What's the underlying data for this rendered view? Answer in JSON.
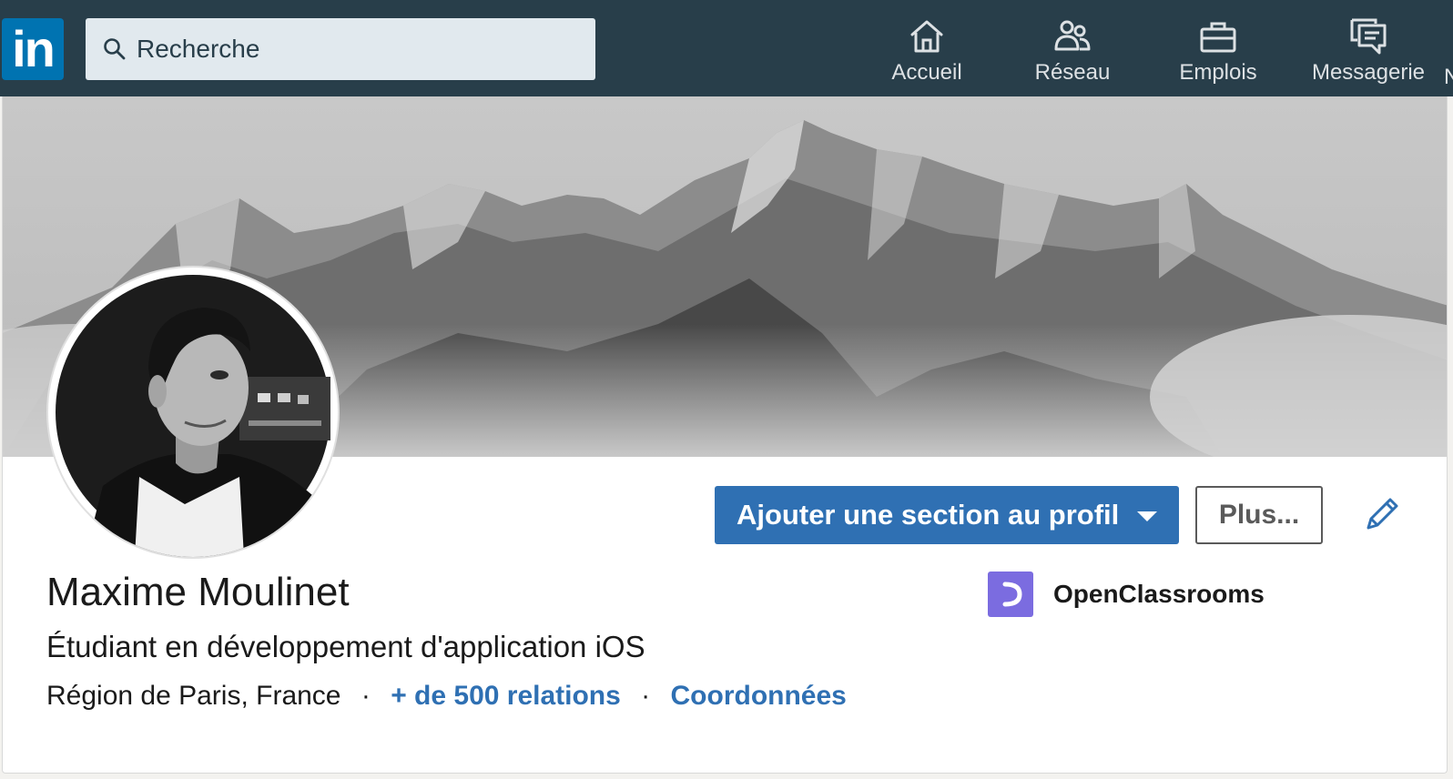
{
  "navbar": {
    "logo_text": "in",
    "search": {
      "placeholder": "Recherche"
    },
    "items": [
      {
        "label": "Accueil",
        "icon": "home-icon"
      },
      {
        "label": "Réseau",
        "icon": "network-icon"
      },
      {
        "label": "Emplois",
        "icon": "briefcase-icon"
      },
      {
        "label": "Messagerie",
        "icon": "messaging-icon"
      }
    ],
    "overflow_text": "N"
  },
  "profile": {
    "name": "Maxime Moulinet",
    "headline": "Étudiant en développement d'application iOS",
    "location": "Région de Paris, France",
    "separator": "·",
    "connections_label": "+ de 500 relations",
    "contact_label": "Coordonnées",
    "company": {
      "name": "OpenClassrooms",
      "icon": "openclassrooms-logo"
    }
  },
  "actions": {
    "add_section_label": "Ajouter une section au profil",
    "more_label": "Plus...",
    "edit_icon": "pencil-icon"
  },
  "colors": {
    "navbar_bg": "#283e4a",
    "accent_blue": "#2f70b3",
    "logo_blue": "#0073b1",
    "company_purple": "#7b6ce0"
  }
}
